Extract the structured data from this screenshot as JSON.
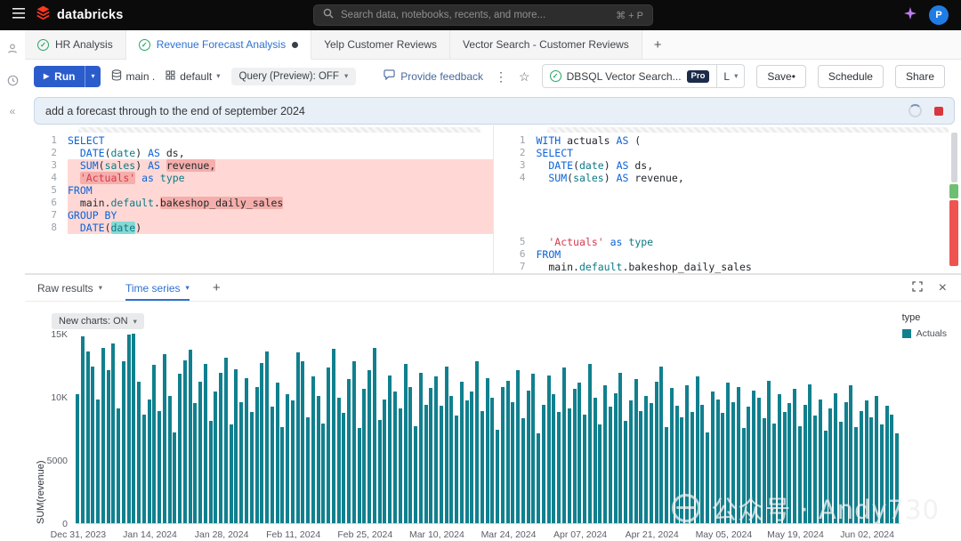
{
  "colors": {
    "accent_blue": "#2d72d2",
    "run_button_blue": "#2b5ccc",
    "logo_red": "#ff3621",
    "bar_teal": "#11808e",
    "diff_removed_bg": "#ffd8d5",
    "diff_removed_mark": "#f5aeab",
    "diff_added_green": "#6fbf73",
    "diff_removed_red": "#ef5350",
    "stop_red": "#d9363e"
  },
  "topbar": {
    "logo": "databricks",
    "search_placeholder": "Search data, notebooks, recents, and more...",
    "search_shortcut": "⌘ + P",
    "avatar": "P"
  },
  "tabs": [
    {
      "label": "HR Analysis"
    },
    {
      "label": "Revenue Forecast Analysis"
    },
    {
      "label": "Yelp Customer Reviews"
    },
    {
      "label": "Vector Search - Customer Reviews"
    }
  ],
  "toolbar": {
    "run": "Run",
    "catalog": "main .",
    "schema": "default",
    "query_mode": "Query (Preview): OFF",
    "feedback": "Provide feedback",
    "warehouse_name": "DBSQL Vector Search...",
    "warehouse_badge": "Pro",
    "warehouse_size": "L",
    "save": "Save•",
    "schedule": "Schedule",
    "share": "Share"
  },
  "prompt": {
    "text": "add a forecast through to the end of september 2024"
  },
  "editor": {
    "left_lines": [
      {
        "n": 1,
        "removed": false,
        "tokens": [
          [
            "SELECT",
            "kw"
          ]
        ]
      },
      {
        "n": 2,
        "removed": false,
        "tokens": [
          [
            "  "
          ],
          [
            "DATE",
            "kw"
          ],
          [
            "("
          ],
          [
            "date",
            "id"
          ],
          [
            ")"
          ],
          [
            " "
          ],
          [
            "AS",
            "kw"
          ],
          [
            " ds,"
          ]
        ]
      },
      {
        "n": 3,
        "removed": true,
        "tokens": [
          [
            "  "
          ],
          [
            "SUM",
            "kw"
          ],
          [
            "("
          ],
          [
            "sales",
            "id"
          ],
          [
            ")"
          ],
          [
            " "
          ],
          [
            "AS",
            "kw"
          ],
          [
            " "
          ],
          [
            "revenue,",
            "",
            "red"
          ]
        ]
      },
      {
        "n": 4,
        "removed": true,
        "tokens": [
          [
            "  "
          ],
          [
            "'Actuals'",
            "str",
            "red"
          ],
          [
            " "
          ],
          [
            "as",
            "kw"
          ],
          [
            " "
          ],
          [
            "type",
            "id"
          ]
        ]
      },
      {
        "n": 5,
        "removed": true,
        "tokens": [
          [
            "FROM",
            "kw"
          ]
        ]
      },
      {
        "n": 6,
        "removed": true,
        "tokens": [
          [
            "  main."
          ],
          [
            "default",
            "id"
          ],
          [
            "."
          ],
          [
            "bakeshop_daily_sales",
            "",
            "red"
          ]
        ]
      },
      {
        "n": 7,
        "removed": true,
        "tokens": [
          [
            "GROUP BY",
            "kw"
          ]
        ]
      },
      {
        "n": 8,
        "removed": true,
        "tokens": [
          [
            "  "
          ],
          [
            "DATE",
            "kw"
          ],
          [
            "("
          ],
          [
            "date",
            "id",
            "teal"
          ],
          [
            ")"
          ]
        ]
      }
    ],
    "right_lines": [
      {
        "n": 1,
        "removed": false,
        "tokens": [
          [
            "WITH",
            "kw"
          ],
          [
            " actuals "
          ],
          [
            "AS",
            "kw"
          ],
          [
            " ("
          ]
        ]
      },
      {
        "n": 2,
        "removed": false,
        "tokens": [
          [
            "SELECT",
            "kw"
          ]
        ]
      },
      {
        "n": 3,
        "removed": false,
        "tokens": [
          [
            "  "
          ],
          [
            "DATE",
            "kw"
          ],
          [
            "("
          ],
          [
            "date",
            "id"
          ],
          [
            ")"
          ],
          [
            " "
          ],
          [
            "AS",
            "kw"
          ],
          [
            " ds,"
          ]
        ]
      },
      {
        "n": 4,
        "removed": false,
        "tokens": [
          [
            "  "
          ],
          [
            "SUM",
            "kw"
          ],
          [
            "("
          ],
          [
            "sales",
            "id"
          ],
          [
            ")"
          ],
          [
            " "
          ],
          [
            "AS",
            "kw"
          ],
          [
            " revenue,"
          ]
        ]
      },
      {
        "spacer": 58
      },
      {
        "n": 5,
        "removed": false,
        "tokens": [
          [
            "  "
          ],
          [
            "'Actuals'",
            "str"
          ],
          [
            " "
          ],
          [
            "as",
            "kw"
          ],
          [
            " "
          ],
          [
            "type",
            "id"
          ]
        ]
      },
      {
        "n": 6,
        "removed": false,
        "tokens": [
          [
            "FROM",
            "kw"
          ]
        ]
      },
      {
        "n": 7,
        "removed": false,
        "tokens": [
          [
            "  main."
          ],
          [
            "default",
            "id"
          ],
          [
            ".bakeshop_daily_sales"
          ]
        ]
      }
    ]
  },
  "results": {
    "tab_raw": "Raw results",
    "tab_timeseries": "Time series",
    "new_charts": "New charts: ON",
    "legend_title": "type",
    "legend_item": "Actuals"
  },
  "watermark": {
    "text": "公众号 · Andy730"
  },
  "chart_data": {
    "type": "bar",
    "title": "",
    "xlabel": "",
    "ylabel": "SUM(revenue)",
    "ylim": [
      0,
      15000
    ],
    "bar_color": "#11808e",
    "legend_position": "top-right",
    "grid": false,
    "start_label": "Dec 31, 2023",
    "tick_interval_days": 14,
    "x_tick_labels": [
      "Dec 31, 2023",
      "Jan 14, 2024",
      "Jan 28, 2024",
      "Feb 11, 2024",
      "Feb 25, 2024",
      "Mar 10, 2024",
      "Mar 24, 2024",
      "Apr 07, 2024",
      "Apr 21, 2024",
      "May 05, 2024",
      "May 19, 2024",
      "Jun 02, 2024"
    ],
    "y_tick_labels": [
      "15K",
      "10K",
      "5000",
      "0"
    ],
    "series": [
      {
        "name": "Actuals",
        "values": [
          10200,
          14800,
          13600,
          12400,
          9800,
          13900,
          12100,
          14200,
          9100,
          12800,
          14900,
          15000,
          11200,
          8600,
          9800,
          12500,
          8900,
          13400,
          10100,
          7200,
          11800,
          12900,
          13700,
          9500,
          11200,
          12600,
          8100,
          10400,
          11900,
          13100,
          7800,
          12200,
          9600,
          11500,
          8800,
          10800,
          12700,
          13600,
          9200,
          11100,
          7600,
          10200,
          9700,
          13500,
          12800,
          8400,
          11600,
          10100,
          7900,
          12300,
          13800,
          9900,
          8700,
          11400,
          12800,
          7500,
          10600,
          12100,
          13900,
          8200,
          9800,
          11700,
          10400,
          9100,
          12600,
          10800,
          7700,
          11900,
          9400,
          10700,
          11600,
          9300,
          12400,
          10100,
          8500,
          11200,
          9700,
          10400,
          12800,
          8900,
          11500,
          9900,
          7400,
          10800,
          11300,
          9600,
          12100,
          8300,
          10500,
          11800,
          7100,
          9400,
          11700,
          10200,
          8800,
          12300,
          9100,
          10600,
          11100,
          8600,
          12600,
          9900,
          7800,
          10900,
          9200,
          10300,
          11900,
          8100,
          9700,
          11400,
          8900,
          10100,
          9500,
          11200,
          12400,
          7600,
          10700,
          9300,
          8400,
          10900,
          8800,
          11600,
          9400,
          7200,
          10400,
          9800,
          8700,
          11100,
          9600,
          10800,
          7500,
          9200,
          10500,
          9900,
          8300,
          11300,
          7900,
          10200,
          8800,
          9500,
          10600,
          7700,
          9400,
          11000,
          8500,
          9800,
          7300,
          9100,
          10300,
          8000,
          9600,
          10900,
          7600,
          8900,
          9700,
          8400,
          10100,
          7800,
          9300,
          8600,
          7100
        ]
      }
    ]
  }
}
